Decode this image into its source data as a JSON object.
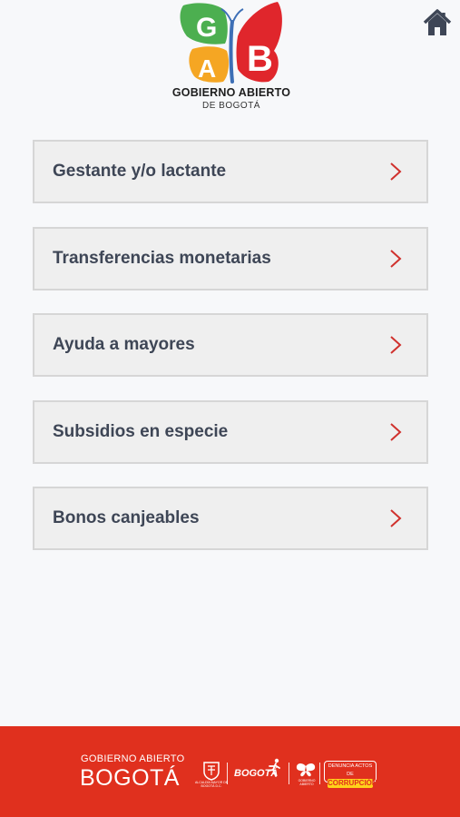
{
  "header": {
    "logo_title": "GOBIERNO ABIERTO",
    "logo_subtitle": "DE BOGOTÁ",
    "logo_letters": "GAB",
    "home_icon": "home-icon"
  },
  "menu": {
    "items": [
      {
        "label": "Gestante y/o lactante",
        "icon": "chevron-right-icon"
      },
      {
        "label": "Transferencias monetarias",
        "icon": "chevron-right-icon"
      },
      {
        "label": "Ayuda a mayores",
        "icon": "chevron-right-icon"
      },
      {
        "label": "Subsidios en especie",
        "icon": "chevron-right-icon"
      },
      {
        "label": "Bonos canjeables",
        "icon": "chevron-right-icon"
      }
    ]
  },
  "footer": {
    "title": "GOBIERNO ABIERTO",
    "city": "BOGOTÁ",
    "seal_caption": "ALCALDÍA MAYOR DE BOGOTÁ D.C.",
    "bogota_brand": "BOGOTÁ",
    "butterfly_caption": "GOBIERNO ABIERTO",
    "badge_top": "DENUNCIA ACTOS DE",
    "badge_bottom": "CORRUPCIÓN"
  },
  "colors": {
    "background": "#f7f8fa",
    "item_background": "#efefef",
    "item_border": "#d6d6d6",
    "label": "#3e4656",
    "chevron": "#d0312d",
    "footer": "#e0301e",
    "logo_green": "#4caf50",
    "logo_orange": "#f5a623",
    "logo_red": "#e0262c"
  }
}
